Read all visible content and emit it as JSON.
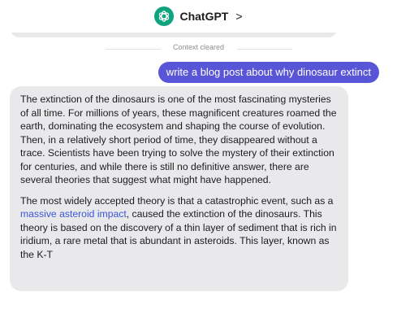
{
  "header": {
    "title": "ChatGPT",
    "chevron": ">",
    "logo_icon": "openai-logo-icon"
  },
  "divider": {
    "label": "Context cleared"
  },
  "user_message": {
    "text": "write a blog post about why dinosaur extinct"
  },
  "assistant_message": {
    "paragraph_1": "The extinction of the dinosaurs is one of the most fascinating mysteries of all time. For millions of years, these magnificent creatures roamed the earth, dominating the ecosystem and shaping the course of evolution. Then, in a relatively short period of time, they disappeared without a trace. Scientists have been trying to solve the mystery of their extinction for centuries, and while there is still no definitive answer, there are several theories that suggest what might have happened.",
    "paragraph_2_before": "The most widely accepted theory is that a catastrophic event, such as a ",
    "paragraph_2_link": "massive asteroid impact",
    "paragraph_2_after": ", caused the extinction of the dinosaurs. This theory is based on the discovery of a thin layer of sediment that is rich in iridium, a rare metal that is abundant in asteroids. This layer, known as the K-T"
  },
  "colors": {
    "accent": "#5856d6",
    "bubble": "#e9e9eb",
    "link": "#3b56d9",
    "logo": "#10a37f"
  }
}
